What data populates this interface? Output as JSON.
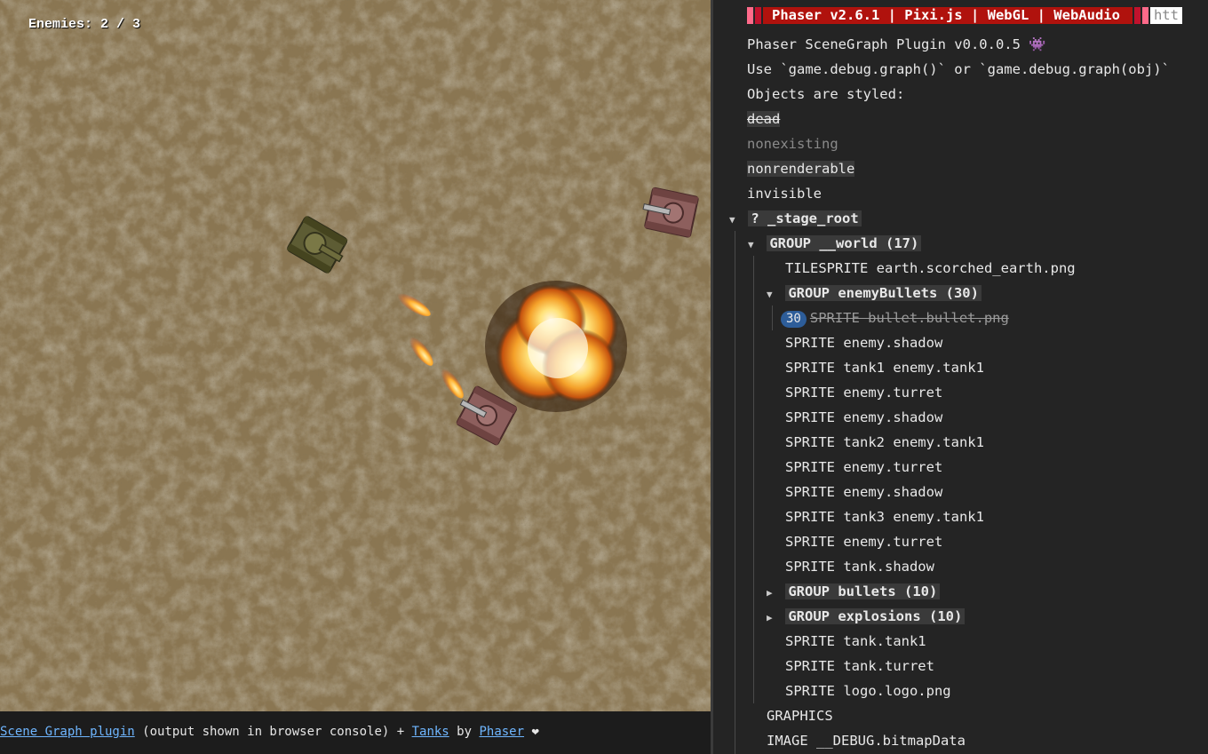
{
  "game": {
    "hud_text": "Enemies: 2 / 3"
  },
  "footer": {
    "link1": "Scene Graph plugin",
    "text1": " (output shown in browser console) + ",
    "link2": "Tanks",
    "text2": " by ",
    "link3": "Phaser",
    "heart": " ❤"
  },
  "console": {
    "banner": "Phaser v2.6.1 | Pixi.js | WebGL | WebAudio",
    "banner_url": "htt",
    "lines": [
      "Phaser SceneGraph Plugin v0.0.0.5 👾",
      "Use `game.debug.graph()` or `game.debug.graph(obj)`",
      "Objects are styled:"
    ],
    "styles": {
      "dead": "dead",
      "nonexisting": "nonexisting",
      "nonrenderable": "nonrenderable",
      "invisible": "invisible"
    },
    "tree": {
      "root": "? _stage_root",
      "world": "GROUP __world (17)",
      "tilesprite": "TILESPRITE earth.scorched_earth.png",
      "enemy_bullets": "GROUP enemyBullets (30)",
      "bullet_count": "30",
      "bullet": "SPRITE bullet.bullet.png",
      "world_items": [
        "SPRITE enemy.shadow",
        "SPRITE tank1 enemy.tank1",
        "SPRITE enemy.turret",
        "SPRITE enemy.shadow",
        "SPRITE tank2 enemy.tank1",
        "SPRITE enemy.turret",
        "SPRITE enemy.shadow",
        "SPRITE tank3 enemy.tank1",
        "SPRITE enemy.turret",
        "SPRITE tank.shadow"
      ],
      "bullets_group": "GROUP bullets (10)",
      "explosions_group": "GROUP explosions (10)",
      "world_tail": [
        "SPRITE tank.tank1",
        "SPRITE tank.turret",
        "SPRITE logo.logo.png"
      ],
      "root_tail": [
        "GRAPHICS",
        "IMAGE __DEBUG.bitmapData"
      ]
    }
  },
  "colors": {
    "banner_red": "#b0120d",
    "stripe_pink": "#ff6a8a",
    "link_blue": "#6fb6ff",
    "ground": "#7f6d4d"
  }
}
